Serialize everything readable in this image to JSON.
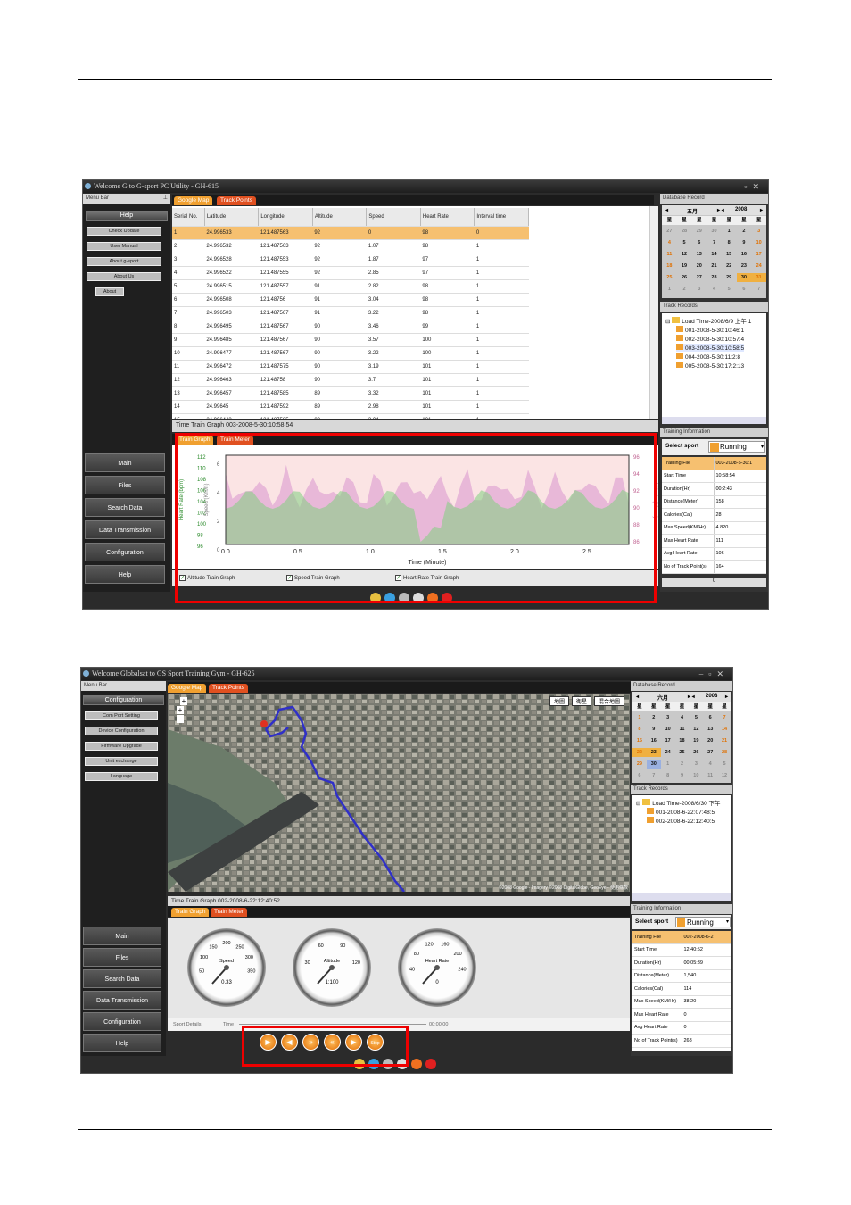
{
  "window1": {
    "title": "Welcome G to G-sport PC Utility - GH-615",
    "menu_bar": "Menu Bar",
    "section_header": "Help",
    "sub_buttons": [
      "Check Update",
      "User Manual",
      "About g-sport",
      "About Us",
      "About"
    ],
    "menu_buttons": [
      "Main",
      "Files",
      "Search Data",
      "Data Transmission",
      "Configuration",
      "Help"
    ],
    "tabs": [
      "Google Map",
      "Track Points"
    ],
    "table": {
      "headers": [
        "Serial No.",
        "Latitude",
        "Longitude",
        "Altitude",
        "Speed",
        "Heart Rate",
        "Interval time"
      ],
      "rows": [
        [
          "1",
          "24.996533",
          "121.487563",
          "92",
          "0",
          "98",
          "0"
        ],
        [
          "2",
          "24.996532",
          "121.487563",
          "92",
          "1.07",
          "98",
          "1"
        ],
        [
          "3",
          "24.996528",
          "121.487553",
          "92",
          "1.87",
          "97",
          "1"
        ],
        [
          "4",
          "24.996522",
          "121.487555",
          "92",
          "2.85",
          "97",
          "1"
        ],
        [
          "5",
          "24.996515",
          "121.487557",
          "91",
          "2.82",
          "98",
          "1"
        ],
        [
          "6",
          "24.996508",
          "121.48756",
          "91",
          "3.04",
          "98",
          "1"
        ],
        [
          "7",
          "24.996503",
          "121.487567",
          "91",
          "3.22",
          "98",
          "1"
        ],
        [
          "8",
          "24.996495",
          "121.487567",
          "90",
          "3.46",
          "99",
          "1"
        ],
        [
          "9",
          "24.996485",
          "121.487567",
          "90",
          "3.57",
          "100",
          "1"
        ],
        [
          "10",
          "24.996477",
          "121.487567",
          "90",
          "3.22",
          "100",
          "1"
        ],
        [
          "11",
          "24.996472",
          "121.487575",
          "90",
          "3.19",
          "101",
          "1"
        ],
        [
          "12",
          "24.996463",
          "121.48758",
          "90",
          "3.7",
          "101",
          "1"
        ],
        [
          "13",
          "24.996457",
          "121.487585",
          "89",
          "3.32",
          "101",
          "1"
        ],
        [
          "14",
          "24.99645",
          "121.487592",
          "89",
          "2.98",
          "101",
          "1"
        ],
        [
          "15",
          "24.996443",
          "121.487585",
          "89",
          "3.04",
          "101",
          "1"
        ]
      ]
    },
    "graph_header": "Time Train Graph 003-2008-5-30:10:58:54",
    "graph_tabs": [
      "Train Graph",
      "Train Meter"
    ],
    "graph": {
      "y_left_ticks": [
        "112",
        "110",
        "108",
        "106",
        "104",
        "102",
        "100",
        "98",
        "96"
      ],
      "y_left_label": "Heart Rate (bpm)",
      "y_left2_ticks": [
        "6",
        "4",
        "2",
        "0"
      ],
      "y_left2_label": "Speed (Km/h)",
      "y_right_ticks": [
        "96",
        "94",
        "92",
        "90",
        "88",
        "86"
      ],
      "y_right_label": "Altitude (Meter)",
      "x_ticks": [
        "0.0",
        "0.5",
        "1.0",
        "1.5",
        "2.0",
        "2.5"
      ],
      "x_label": "Time (Minute)"
    },
    "checkboxes": [
      "Altitude Train Graph",
      "Speed Train Graph",
      "Heart Rate Train Graph"
    ],
    "database_record": "Database Record",
    "calendar": {
      "month": "五月",
      "year": "2008",
      "weekdays": [
        "星",
        "星",
        "星",
        "星",
        "星",
        "星",
        "星"
      ],
      "days": [
        "27",
        "28",
        "29",
        "30",
        "1",
        "2",
        "3",
        "4",
        "5",
        "6",
        "7",
        "8",
        "9",
        "10",
        "11",
        "12",
        "13",
        "14",
        "15",
        "16",
        "17",
        "18",
        "19",
        "20",
        "21",
        "22",
        "23",
        "24",
        "25",
        "26",
        "27",
        "28",
        "29",
        "30",
        "31",
        "1",
        "2",
        "3",
        "4",
        "5",
        "6",
        "7"
      ]
    },
    "track_records": "Track Records",
    "tree": {
      "root": "Load Time-2008/6/9 上午 1",
      "items": [
        "001-2008-5-30:10:46:1",
        "002-2008-5-30:10:57:4",
        "003-2008-5-30:10:58:5",
        "004-2008-5-30:11:2:8",
        "005-2008-5-30:17:2:13"
      ]
    },
    "training_information": "Training Information",
    "select_sport_label": "Select sport",
    "sport": "Running",
    "info": [
      [
        "Training File",
        "003-2008-5-30:1"
      ],
      [
        "Start Time",
        "10:58:54"
      ],
      [
        "Duration(Hr)",
        "00:2:43"
      ],
      [
        "Distance(Meter)",
        "158"
      ],
      [
        "Calories(Cal)",
        "28"
      ],
      [
        "Max Speed(KM/Hr)",
        "4.820"
      ],
      [
        "Max Heart Rate",
        "111"
      ],
      [
        "Avg Heart Rate",
        "106"
      ],
      [
        "No of Track Point(s)",
        "164"
      ]
    ],
    "scroll_value": "0"
  },
  "window2": {
    "title": "Welcome Globalsat to GS Sport Training Gym - GH-625",
    "menu_bar": "Menu Bar",
    "section_header": "Configuration",
    "sub_buttons": [
      "Com Port Setting",
      "Device Configuration",
      "Firmware Upgrade",
      "Unit exchange",
      "Language"
    ],
    "menu_buttons": [
      "Main",
      "Files",
      "Search Data",
      "Data Transmission",
      "Configuration",
      "Help"
    ],
    "tabs": [
      "Google Map",
      "Track Points"
    ],
    "map_types": [
      "地圖",
      "衛星",
      "混合地圖"
    ],
    "map_credit": "©2008 Google - Imagery ©2008 DigitalGlobe, GeoEye - 使用條款",
    "graph_header": "Time Train Graph 002-2008-6-22:12:40:52",
    "graph_tabs": [
      "Train Graph",
      "Train Meter"
    ],
    "gauges": [
      {
        "name": "Speed",
        "value": "0.33",
        "ticks": [
          "50",
          "100",
          "150",
          "200",
          "250",
          "300",
          "350"
        ]
      },
      {
        "name": "Altitude",
        "value": "1:100",
        "ticks": [
          "30",
          "60",
          "90",
          "120"
        ]
      },
      {
        "name": "Heart Rate",
        "value": "0",
        "ticks": [
          "40",
          "80",
          "120",
          "160",
          "200",
          "240"
        ]
      }
    ],
    "sport_details": "Sport Details",
    "time_label": "Time",
    "end_time": "00:00:00",
    "controls": [
      "play",
      "previous",
      "fast-forward",
      "rewind",
      "next",
      "stop"
    ],
    "stop_label": "Stop",
    "database_record": "Database Record",
    "calendar": {
      "month": "六月",
      "year": "2008",
      "weekdays": [
        "星",
        "星",
        "星",
        "星",
        "星",
        "星",
        "星"
      ],
      "days": [
        "1",
        "2",
        "3",
        "4",
        "5",
        "6",
        "7",
        "8",
        "9",
        "10",
        "11",
        "12",
        "13",
        "14",
        "15",
        "16",
        "17",
        "18",
        "19",
        "20",
        "21",
        "22",
        "23",
        "24",
        "25",
        "26",
        "27",
        "28",
        "29",
        "30",
        "1",
        "2",
        "3",
        "4",
        "5",
        "6",
        "7",
        "8",
        "9",
        "10",
        "11",
        "12"
      ]
    },
    "track_records": "Track Records",
    "tree": {
      "root": "Load Time-2008/6/30 下午",
      "items": [
        "001-2008-6-22:07:48:5",
        "002-2008-6-22:12:40:5"
      ]
    },
    "training_information": "Training Information",
    "select_sport_label": "Select sport",
    "sport": "Running",
    "info": [
      [
        "Training File",
        "002-2008-6-2"
      ],
      [
        "Start Time",
        "12:40:52"
      ],
      [
        "Duration(Hr)",
        "00:05:39"
      ],
      [
        "Distance(Meter)",
        "1,540"
      ],
      [
        "Calories(Cal)",
        "114"
      ],
      [
        "Max Speed(KM/Hr)",
        "38.20"
      ],
      [
        "Max Heart Rate",
        "0"
      ],
      [
        "Avg Heart Rate",
        "0"
      ],
      [
        "No of Track Point(s)",
        "268"
      ],
      [
        "No of Lap(s)",
        "0"
      ]
    ]
  }
}
